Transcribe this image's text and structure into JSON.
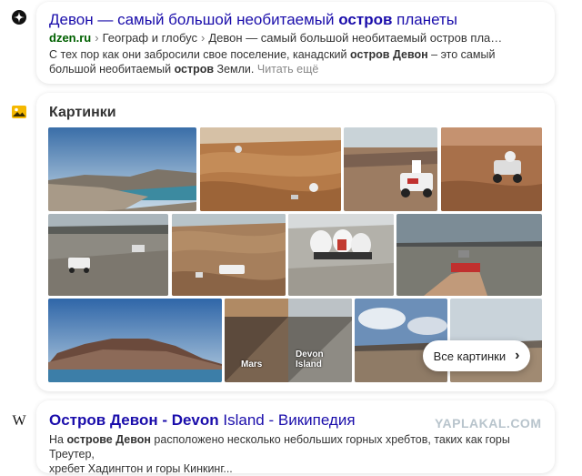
{
  "result1": {
    "title_pre": "Девон — самый большой необитаемый ",
    "title_bold": "остров",
    "title_post": " планеты",
    "host": "dzen.ru",
    "breadcrumb": [
      "Географ и глобус",
      "Девон — самый большой необитаемый остров пла…"
    ],
    "snippet_pre": "С тех пор как они забросили свое поселение, канадский ",
    "snippet_bold1": "остров Девон",
    "snippet_mid": " – это самый большой необитаемый ",
    "snippet_bold2": "остров",
    "snippet_post": " Земли. ",
    "read_more": "Читать ещё"
  },
  "images": {
    "title": "Картинки",
    "all_button": "Все картинки",
    "captions": [
      "Mars",
      "Devon Island"
    ]
  },
  "result2": {
    "title_bold": "Остров Девон - Devon",
    "title_rest": " Island - Википедия",
    "snippet_pre": "На ",
    "snippet_bold": "острове Девон",
    "snippet_post": " расположено несколько небольших горных хребтов, таких как горы Треутер,",
    "snippet_line2": "хребет Хадингтон и горы Кинкинг..."
  },
  "watermark": "YAPLAKAL.COM",
  "colors": {
    "link": "#1a0dab",
    "url_host": "#006000",
    "text": "#333333"
  }
}
